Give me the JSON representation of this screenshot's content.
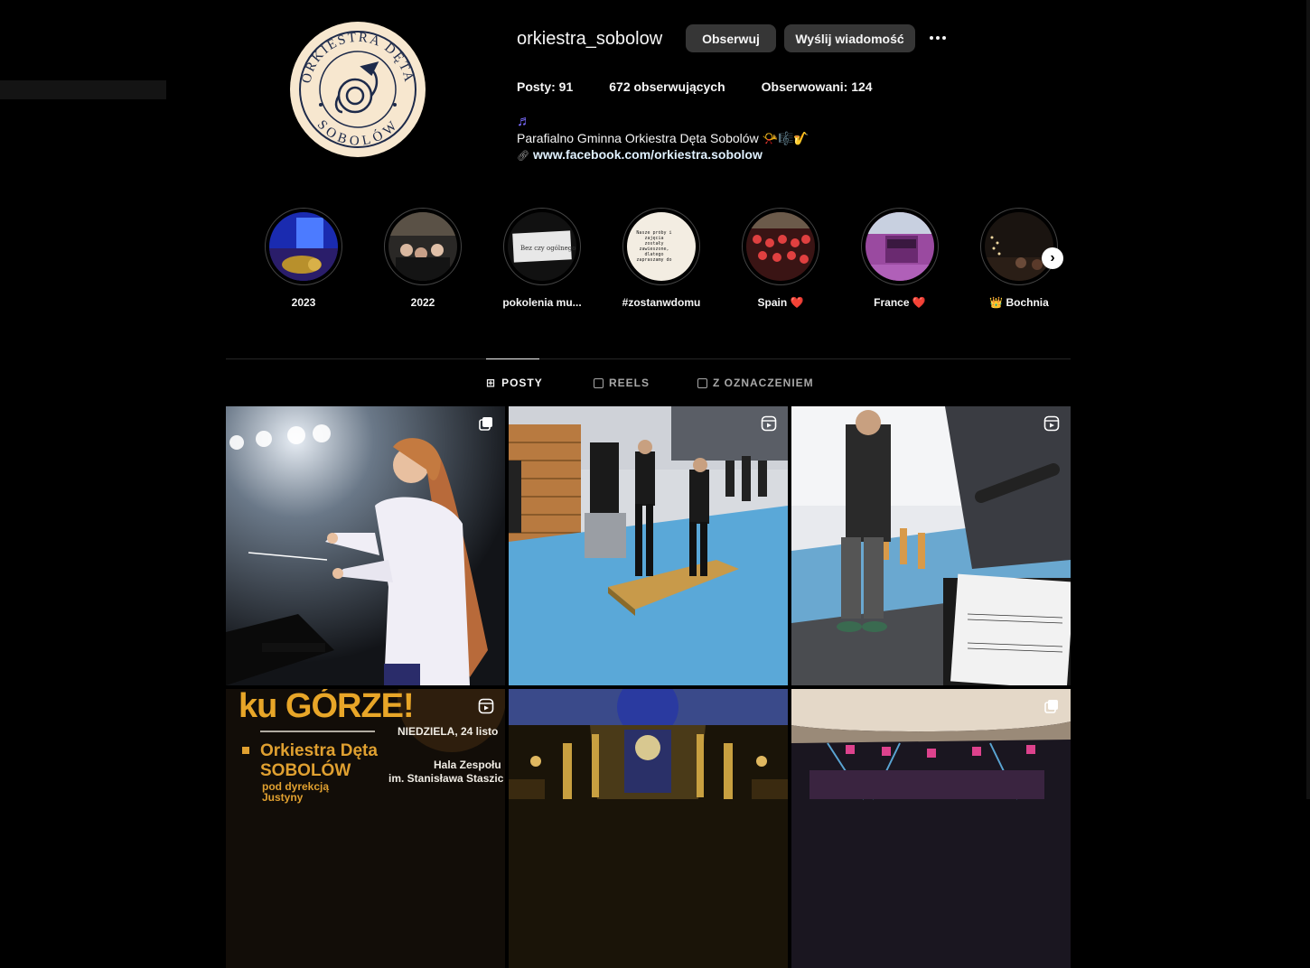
{
  "profile": {
    "username": "orkiestra_sobolow",
    "follow_label": "Obserwuj",
    "message_label": "Wyślij wiadomość",
    "avatar_text_top": "ORKIESTRA DĘTA",
    "avatar_text_bottom": "SOBOLÓW"
  },
  "stats": {
    "posts": "Posty: 91",
    "followers": "672 obserwujących",
    "following": "Obserwowani: 124"
  },
  "bio": {
    "emoji_line": "♬",
    "text": "Parafialno Gminna Orkiestra Dęta Sobolów 📯🎼🎷",
    "link": "www.facebook.com/orkiestra.sobolow",
    "link_icon": "link-icon"
  },
  "highlights": [
    {
      "label": "2023"
    },
    {
      "label": "2022"
    },
    {
      "label": "pokolenia mu..."
    },
    {
      "label": "#zostanwdomu"
    },
    {
      "label": "Spain ❤️"
    },
    {
      "label": "France ❤️"
    },
    {
      "label": "👑 Bochnia"
    }
  ],
  "tabs": [
    {
      "label": "POSTY",
      "active": true
    },
    {
      "label": "REELS",
      "active": false
    },
    {
      "label": "Z OZNACZENIEM",
      "active": false
    }
  ],
  "posts": [
    {
      "type": "carousel"
    },
    {
      "type": "reel"
    },
    {
      "type": "reel"
    },
    {
      "type": "reel"
    },
    {
      "type": "image"
    },
    {
      "type": "carousel"
    }
  ],
  "post4_text": {
    "headline": "ku GÓRZE!",
    "band_line1": "Orkiestra Dęta",
    "band_line2": "SOBOLÓW",
    "band_line3": "pod dyrekcją",
    "band_line4": "Justyny",
    "date": "NIEDZIELA, 24 listo",
    "venue1": "Hala Zespołu",
    "venue2": "im. Stanisława Staszic"
  },
  "story_paper_text": "Nasze próby i zajęcia zostały zawieszone, dlatego zapraszamy do",
  "story_note_text": "Bez czy ogólnego"
}
